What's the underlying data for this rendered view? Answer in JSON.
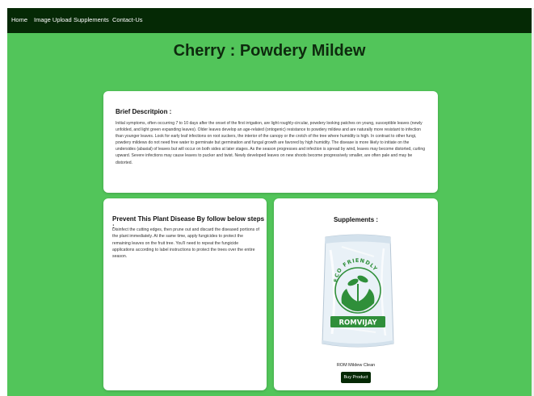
{
  "nav": {
    "items": [
      {
        "label": "Home"
      },
      {
        "label": "Image Upload"
      },
      {
        "label": "Supplements"
      },
      {
        "label": "Contact-Us"
      }
    ]
  },
  "page": {
    "title": "Cherry : Powdery Mildew"
  },
  "description": {
    "heading": "Brief Descritpion :",
    "text": "Initial symptoms, often occurring 7 to 10 days after the onset of the first irrigation, are light roughly-circular, powdery looking patches on young, susceptible leaves (newly unfolded, and light green expanding leaves). Older leaves develop an age-related (ontogenic) resistance to powdery mildew and are naturally more resistant to infection than younger leaves. Look for early leaf infections on root suckers, the interior of the canopy or the crotch of the tree where humidity is high. In contrast to other fungi, powdery mildews do not need free water to germinate but germination and fungal growth are favored by high humidity. The disease is more likely to initiate on the undersides (abaxial) of leaves but will occur on both sides at later stages. As the season progresses and infection is spread by wind, leaves may become distorted, curling upward. Severe infections may cause leaves to pucker and twist. Newly developed leaves on new shoots become progressively smaller, are often pale and may be distorted."
  },
  "prevention": {
    "heading": "Prevent This Plant Disease By follow below steps :",
    "text": "Disinfect the cutting edges, then prune out and discard the diseased portions of the plant immediately. At the same time, apply fungicides to protect the remaining leaves on the fruit tree. You'll need to repeat the fungicide applications according to label instructions to protect the trees over the entire season."
  },
  "supplements": {
    "heading": "Supplements :",
    "product_name": "ROM Mildew Clean",
    "buy_label": "Buy Product",
    "package": {
      "arc_text": "ECO FRIENDLY",
      "brand": "ROMVIJAY"
    }
  },
  "colors": {
    "page_background": "#52c55a",
    "navbar": "#052905",
    "button": "#052905",
    "card": "#ffffff"
  }
}
